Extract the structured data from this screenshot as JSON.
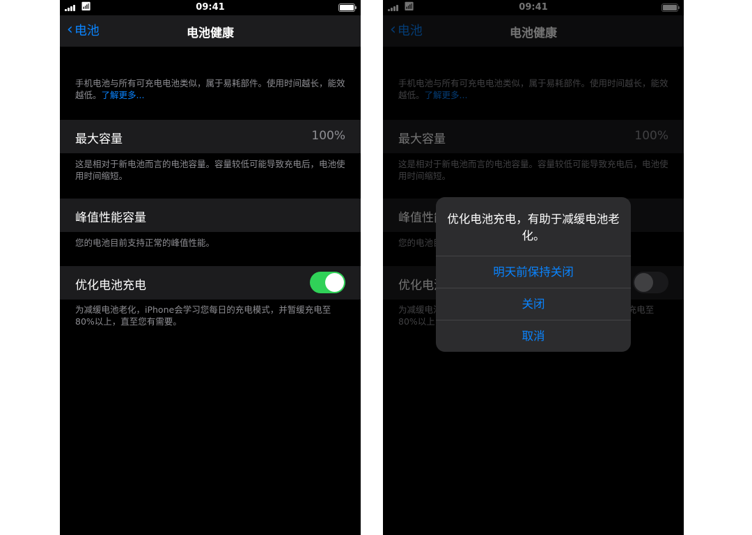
{
  "status": {
    "time": "09:41"
  },
  "nav": {
    "back_label": "电池",
    "title": "电池健康"
  },
  "intro": {
    "text": "手机电池与所有可充电电池类似，属于易耗部件。使用时间越长，能效越低。",
    "link": "了解更多..."
  },
  "max_capacity": {
    "label": "最大容量",
    "value": "100%",
    "footnote": "这是相对于新电池而言的电池容量。容量较低可能导致充电后，电池使用时间缩短。"
  },
  "peak": {
    "label": "峰值性能容量",
    "footnote": "您的电池目前支持正常的峰值性能。"
  },
  "optimized": {
    "label": "优化电池充电",
    "on_left": true,
    "on_right": false,
    "footnote": "为减缓电池老化，iPhone会学习您每日的充电模式，并暂缓充电至80%以上，直至您有需要。"
  },
  "alert": {
    "title": "优化电池充电，有助于减缓电池老化。",
    "buttons": [
      "明天前保持关闭",
      "关闭",
      "取消"
    ]
  },
  "colors": {
    "accent": "#0a84ff",
    "toggle_on": "#30d158",
    "background": "#000000",
    "cell": "#1c1c1e"
  }
}
